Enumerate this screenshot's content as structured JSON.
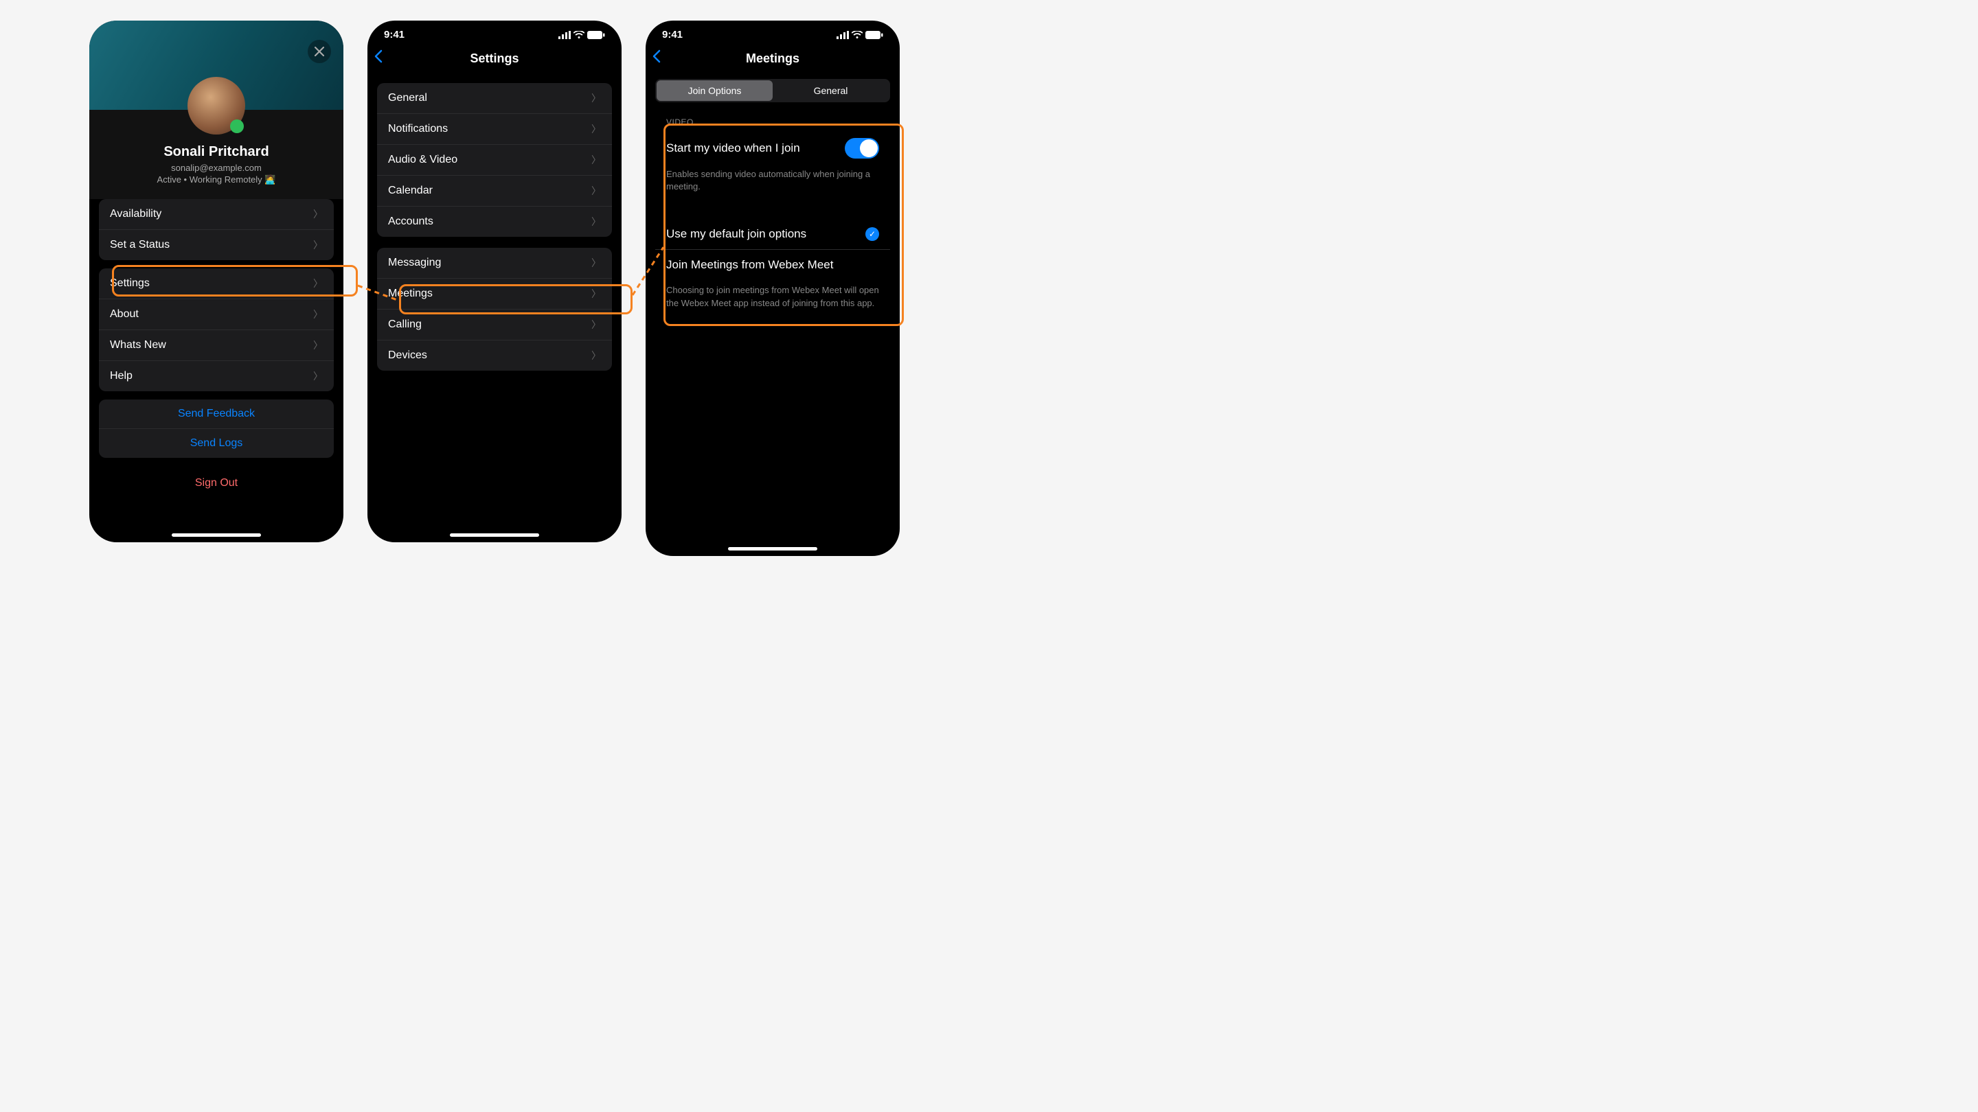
{
  "profile": {
    "name": "Sonali Pritchard",
    "email": "sonalip@example.com",
    "status": "Active • Working Remotely 🧑‍💻"
  },
  "profile_menu": {
    "group1": [
      {
        "label": "Availability"
      },
      {
        "label": "Set a Status"
      }
    ],
    "group2": [
      {
        "label": "Settings"
      },
      {
        "label": "About"
      },
      {
        "label": "Whats New"
      },
      {
        "label": "Help"
      }
    ],
    "actions": [
      {
        "label": "Send Feedback"
      },
      {
        "label": "Send Logs"
      }
    ],
    "signout": "Sign Out"
  },
  "settings_screen": {
    "time": "9:41",
    "title": "Settings",
    "group1": [
      {
        "label": "General"
      },
      {
        "label": "Notifications"
      },
      {
        "label": "Audio & Video"
      },
      {
        "label": "Calendar"
      },
      {
        "label": "Accounts"
      }
    ],
    "group2": [
      {
        "label": "Messaging"
      },
      {
        "label": "Meetings"
      },
      {
        "label": "Calling"
      },
      {
        "label": "Devices"
      }
    ]
  },
  "meetings_screen": {
    "time": "9:41",
    "title": "Meetings",
    "segments": {
      "a": "Join Options",
      "b": "General"
    },
    "video_section": "VIDEO",
    "toggle_label": "Start my video when I join",
    "toggle_desc": "Enables sending video automatically when joining a meeting.",
    "option1": "Use my default join options",
    "option2": "Join Meetings from Webex Meet",
    "option2_desc": "Choosing to join meetings from Webex Meet will open the Webex Meet app instead of joining from this app."
  },
  "colors": {
    "highlight": "#f58220",
    "accent": "#0a84ff"
  }
}
